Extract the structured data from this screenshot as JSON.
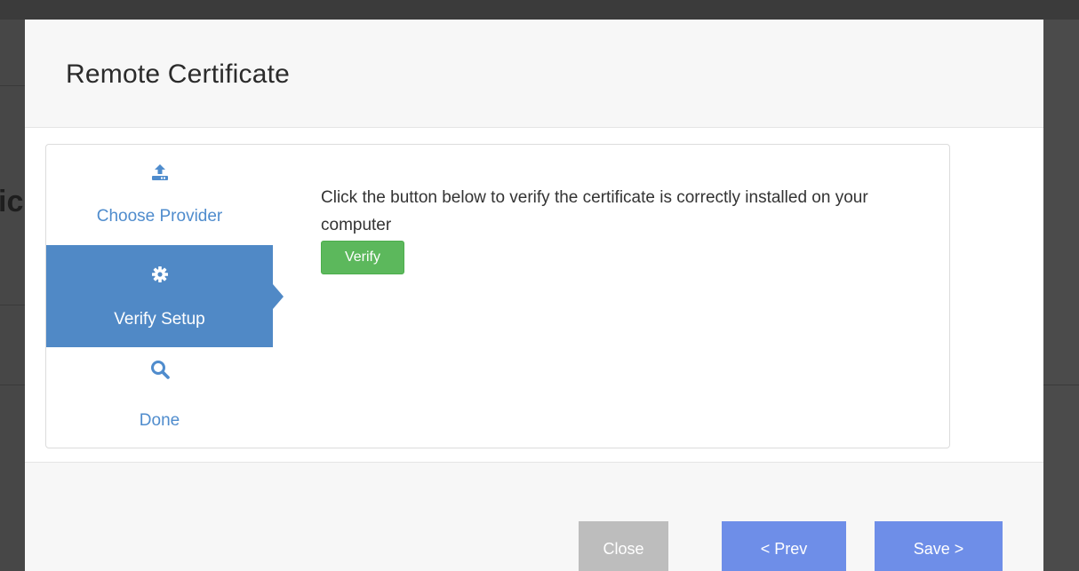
{
  "background": {
    "partial_heading": "ic"
  },
  "modal": {
    "title": "Remote Certificate"
  },
  "wizard": {
    "steps": [
      {
        "label": "Choose Provider",
        "icon": "upload-icon",
        "state": "completed"
      },
      {
        "label": "Verify Setup",
        "icon": "gear-icon",
        "state": "active"
      },
      {
        "label": "Done",
        "icon": "search-icon",
        "state": "pending"
      }
    ],
    "active_step": {
      "text": "Click the button below to verify the certificate is correctly installed on your computer",
      "button_label": "Verify"
    }
  },
  "footer": {
    "close_label": "Close",
    "prev_label": "< Prev",
    "save_label": "Save >"
  },
  "colors": {
    "accent": "#5089c6",
    "link": "#4f8ccd",
    "success": "#5cb85c",
    "primary_button": "#6e8ee8",
    "disabled_button": "#bdbdbd"
  }
}
